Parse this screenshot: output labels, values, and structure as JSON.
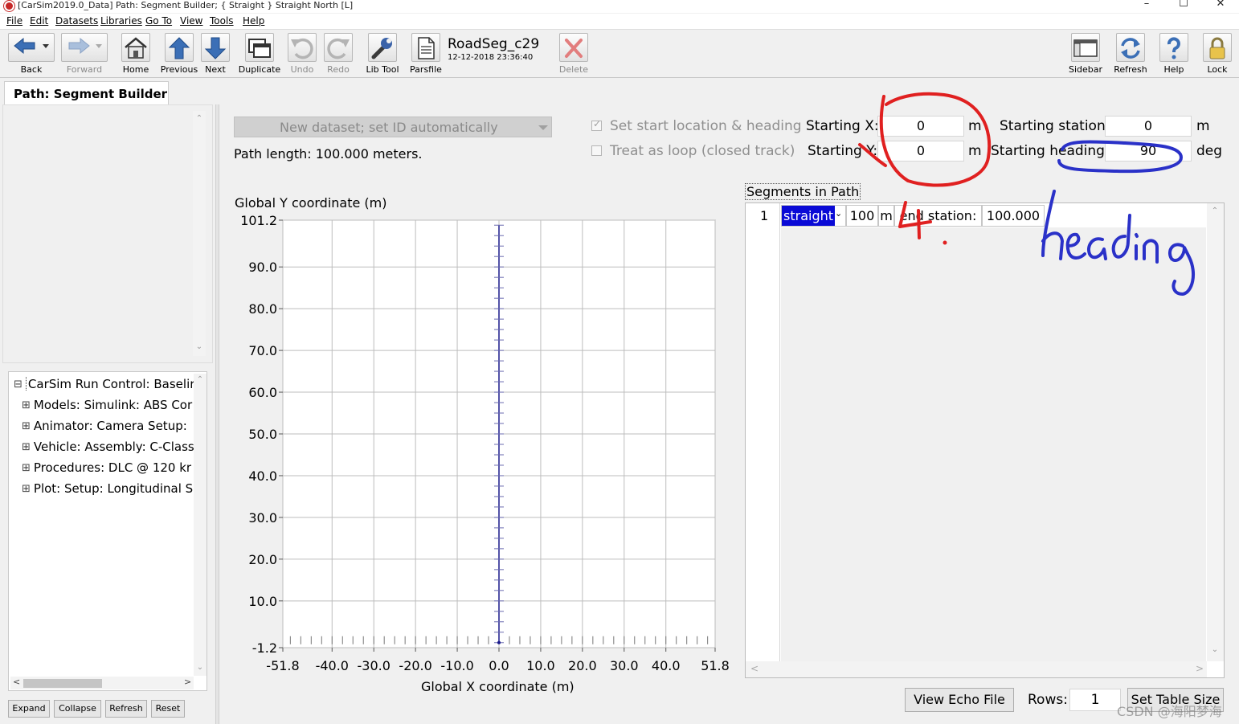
{
  "window": {
    "title": "[CarSim2019.0_Data] Path: Segment Builder; { Straight } Straight North [L]",
    "controls": [
      "–",
      "☐",
      "✕"
    ]
  },
  "menu": [
    "File",
    "Edit",
    "Datasets",
    "Libraries",
    "Go To",
    "View",
    "Tools",
    "Help"
  ],
  "toolbar": {
    "back": "Back",
    "forward": "Forward",
    "home": "Home",
    "previous": "Previous",
    "next": "Next",
    "duplicate": "Duplicate",
    "undo": "Undo",
    "redo": "Redo",
    "lib_tool": "Lib Tool",
    "parsfile": "Parsfile",
    "dataset_name": "RoadSeg_c29",
    "dataset_date": "12-12-2018 23:36:40",
    "delete": "Delete",
    "sidebar": "Sidebar",
    "refresh": "Refresh",
    "help": "Help",
    "lock": "Lock"
  },
  "tab": "Path: Segment Builder",
  "tree": {
    "items": [
      {
        "symbol": "⊟",
        "label": "CarSim Run Control: Baselir"
      },
      {
        "symbol": "⊞",
        "label": "Models: Simulink: ABS Cor"
      },
      {
        "symbol": "⊞",
        "label": "Animator: Camera Setup:"
      },
      {
        "symbol": "⊞",
        "label": "Vehicle: Assembly: C-Class"
      },
      {
        "symbol": "⊞",
        "label": "Procedures: DLC @ 120 kr"
      },
      {
        "symbol": "⊞",
        "label": "Plot: Setup: Longitudinal S"
      }
    ],
    "buttons": [
      "Expand",
      "Collapse",
      "Refresh",
      "Reset"
    ]
  },
  "form": {
    "dataset_dropdown": "New dataset; set ID automatically",
    "path_length": "Path length: 100.000 meters.",
    "set_start_label": "Set start location & heading",
    "set_start_checked": true,
    "loop_label": "Treat as loop (closed track)",
    "loop_checked": false,
    "start_x_label": "Starting X:",
    "start_x_value": "0",
    "start_x_unit": "m",
    "start_y_label": "Starting Y:",
    "start_y_value": "0",
    "start_y_unit": "m",
    "start_station_label": "Starting station:",
    "start_station_value": "0",
    "start_station_unit": "m",
    "start_heading_label": "Starting heading:",
    "start_heading_value": "90",
    "start_heading_unit": "deg"
  },
  "segments": {
    "title": "Segments in Path",
    "rows": [
      {
        "index": "1",
        "type": "straight",
        "length": "100",
        "unit": "m",
        "end_label": "end station:",
        "end_value": "100.000"
      }
    ],
    "view_echo": "View Echo File",
    "rows_label": "Rows:",
    "rows_value": "1",
    "set_table_size": "Set Table Size"
  },
  "annotations": {
    "handwritten": "heading",
    "handwritten_number": "4."
  },
  "watermark": "CSDN @海阳梦海",
  "chart_data": {
    "type": "line",
    "xlabel": "Global X coordinate (m)",
    "ylabel": "Global Y coordinate (m)",
    "xlim": [
      -51.8,
      51.8
    ],
    "ylim": [
      -1.2,
      101.2
    ],
    "x_ticks": [
      "-51.8",
      "-40.0",
      "-30.0",
      "-20.0",
      "-10.0",
      "0.0",
      "10.0",
      "20.0",
      "30.0",
      "40.0",
      "51.8"
    ],
    "x_tick_values": [
      -51.8,
      -40,
      -30,
      -20,
      -10,
      0,
      10,
      20,
      30,
      40,
      51.8
    ],
    "y_ticks": [
      "101.2",
      "90.0",
      "80.0",
      "70.0",
      "60.0",
      "50.0",
      "40.0",
      "30.0",
      "20.0",
      "10.0",
      "-1.2"
    ],
    "y_tick_values": [
      101.2,
      90,
      80,
      70,
      60,
      50,
      40,
      30,
      20,
      10,
      -1.2
    ],
    "grid": true,
    "series": [
      {
        "x": [
          0,
          0
        ],
        "y": [
          0,
          100
        ],
        "color": "#1a1a8c"
      }
    ]
  }
}
